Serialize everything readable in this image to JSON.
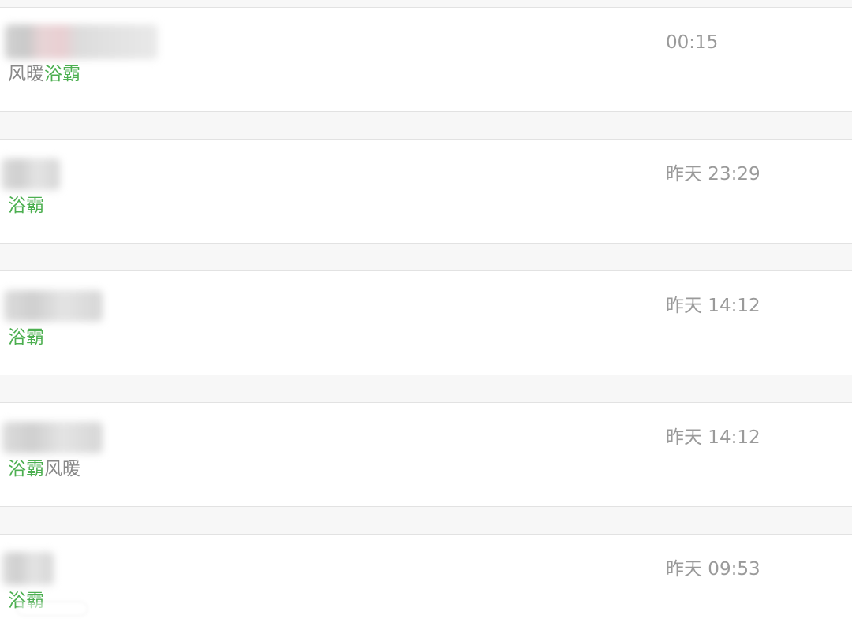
{
  "results": [
    {
      "snippet": [
        {
          "text": "风暖",
          "highlight": false
        },
        {
          "text": "浴霸",
          "highlight": true
        }
      ],
      "time": "00:15"
    },
    {
      "snippet": [
        {
          "text": "浴霸",
          "highlight": true
        }
      ],
      "time": "昨天 23:29"
    },
    {
      "snippet": [
        {
          "text": "浴霸",
          "highlight": true
        }
      ],
      "time": "昨天 14:12"
    },
    {
      "snippet": [
        {
          "text": "浴霸",
          "highlight": true
        },
        {
          "text": "风暖",
          "highlight": false
        }
      ],
      "time": "昨天 14:12"
    },
    {
      "snippet": [
        {
          "text": "浴霸",
          "highlight": true
        }
      ],
      "time": "昨天 09:53"
    }
  ],
  "colors": {
    "background": "#f7f7f7",
    "card": "#ffffff",
    "separator": "#e2e2e2",
    "highlight": "#4caf50",
    "muted_text": "#888888",
    "time_text": "#9a9a9a"
  }
}
